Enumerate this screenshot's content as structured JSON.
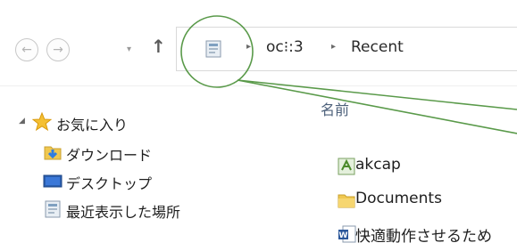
{
  "toolbar": {
    "back_icon": "←",
    "forward_icon": "→",
    "recent_dropdown_icon": "▾",
    "up_icon": "↑"
  },
  "address": {
    "separator": "▸",
    "user_folder": "oc⁝:3",
    "current_folder": "Recent"
  },
  "sidebar": {
    "expand_glyph": "◢",
    "items": [
      {
        "label": "お気に入り",
        "icon": "star-icon"
      },
      {
        "label": "ダウンロード",
        "icon": "downloads-folder-icon"
      },
      {
        "label": "デスクトップ",
        "icon": "desktop-icon"
      },
      {
        "label": "最近表示した場所",
        "icon": "recent-places-icon"
      }
    ]
  },
  "file_list": {
    "column_header": "名前",
    "files": [
      {
        "name": "akcap",
        "icon": "program-icon"
      },
      {
        "name": "Documents",
        "icon": "folder-icon"
      },
      {
        "name": "快適動作させるため",
        "icon": "word-document-icon"
      }
    ]
  },
  "annotation": {
    "color": "#5a9a4a"
  }
}
